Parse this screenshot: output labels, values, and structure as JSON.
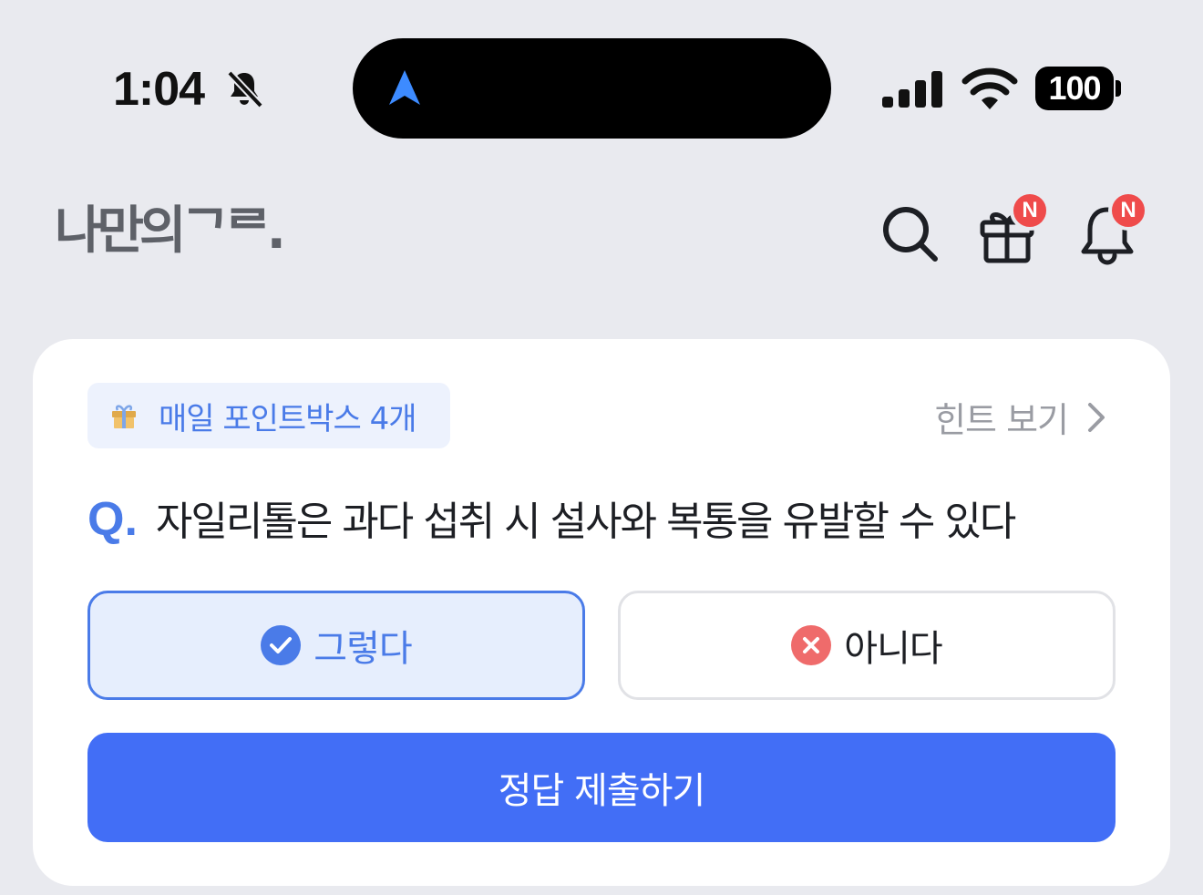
{
  "status_bar": {
    "time": "1:04",
    "battery": "100"
  },
  "header": {
    "logo": "나만의ᄀᄅ.",
    "gift_badge": "N",
    "bell_badge": "N"
  },
  "card": {
    "point_chip": "매일 포인트박스 4개",
    "hint_label": "힌트 보기",
    "question_mark": "Q.",
    "question": "자일리톨은 과다 섭취 시 설사와 복통을 유발할 수 있다",
    "options": [
      {
        "label": "그렇다",
        "selected": true
      },
      {
        "label": "아니다",
        "selected": false
      }
    ],
    "submit_label": "정답 제출하기"
  },
  "colors": {
    "accent": "#4a7be8",
    "submit": "#426ef6",
    "badge": "#ef4b4b",
    "background": "#e9eaef"
  }
}
